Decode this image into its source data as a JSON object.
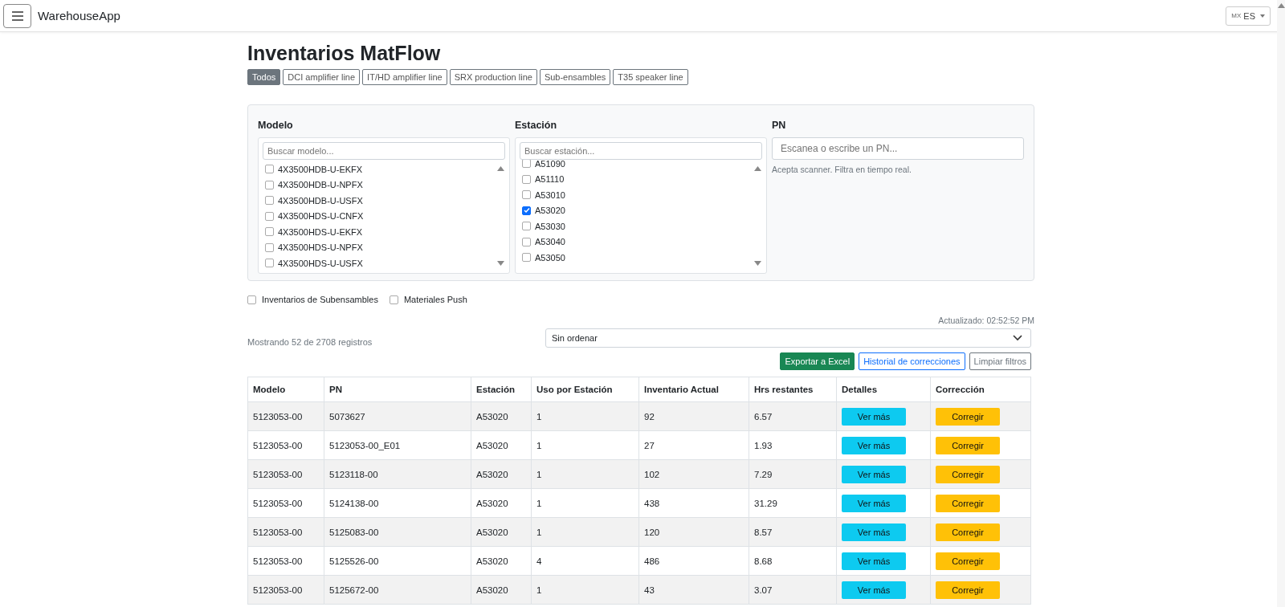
{
  "navbar": {
    "brand": "WarehouseApp",
    "language": {
      "flag": "MX",
      "label": "ES"
    }
  },
  "title": "Inventarios MatFlow",
  "line_tabs": [
    {
      "label": "Todos",
      "selected": true
    },
    {
      "label": "DCI amplifier line",
      "selected": false
    },
    {
      "label": "IT/HD amplifier line",
      "selected": false
    },
    {
      "label": "SRX production line",
      "selected": false
    },
    {
      "label": "Sub-ensambles",
      "selected": false
    },
    {
      "label": "T35 speaker line",
      "selected": false
    }
  ],
  "filters": {
    "modelo": {
      "label": "Modelo",
      "placeholder": "Buscar modelo...",
      "items": [
        {
          "label": "4X3500HDB-U-EKFX",
          "checked": false
        },
        {
          "label": "4X3500HDB-U-NPFX",
          "checked": false
        },
        {
          "label": "4X3500HDB-U-USFX",
          "checked": false
        },
        {
          "label": "4X3500HDS-U-CNFX",
          "checked": false
        },
        {
          "label": "4X3500HDS-U-EKFX",
          "checked": false
        },
        {
          "label": "4X3500HDS-U-NPFX",
          "checked": false
        },
        {
          "label": "4X3500HDS-U-USFX",
          "checked": false
        }
      ]
    },
    "estacion": {
      "label": "Estación",
      "placeholder": "Buscar estación...",
      "items": [
        {
          "label": "A51090",
          "checked": false
        },
        {
          "label": "A51110",
          "checked": false
        },
        {
          "label": "A53010",
          "checked": false
        },
        {
          "label": "A53020",
          "checked": true
        },
        {
          "label": "A53030",
          "checked": false
        },
        {
          "label": "A53040",
          "checked": false
        },
        {
          "label": "A53050",
          "checked": false
        }
      ]
    },
    "pn": {
      "label": "PN",
      "placeholder": "Escanea o escribe un PN...",
      "hint": "Acepta scanner. Filtra en tiempo real."
    }
  },
  "options": [
    {
      "label": "Inventarios de Subensambles",
      "checked": false
    },
    {
      "label": "Materiales Push",
      "checked": false
    }
  ],
  "updated": "Actualizado: 02:52:52 PM",
  "count": "Mostrando 52 de 2708 registros",
  "sort": {
    "value": "Sin ordenar"
  },
  "actions": [
    {
      "label": "Exportar a Excel",
      "kind": "success"
    },
    {
      "label": "Historial de correcciones",
      "kind": "outline-primary"
    },
    {
      "label": "Limpiar filtros",
      "kind": "outline-secondary"
    }
  ],
  "table": {
    "columns": [
      "Modelo",
      "PN",
      "Estación",
      "Uso por Estación",
      "Inventario Actual",
      "Hrs restantes",
      "Detalles",
      "Corrección"
    ],
    "rows": [
      {
        "cells": [
          "5123053-00",
          "5073627",
          "A53020",
          "1",
          "92",
          "6.57"
        ],
        "details": "Ver más",
        "fix": "Corregir"
      },
      {
        "cells": [
          "5123053-00",
          "5123053-00_E01",
          "A53020",
          "1",
          "27",
          "1.93"
        ],
        "details": "Ver más",
        "fix": "Corregir"
      },
      {
        "cells": [
          "5123053-00",
          "5123118-00",
          "A53020",
          "1",
          "102",
          "7.29"
        ],
        "details": "Ver más",
        "fix": "Corregir"
      },
      {
        "cells": [
          "5123053-00",
          "5124138-00",
          "A53020",
          "1",
          "438",
          "31.29"
        ],
        "details": "Ver más",
        "fix": "Corregir"
      },
      {
        "cells": [
          "5123053-00",
          "5125083-00",
          "A53020",
          "1",
          "120",
          "8.57"
        ],
        "details": "Ver más",
        "fix": "Corregir"
      },
      {
        "cells": [
          "5123053-00",
          "5125526-00",
          "A53020",
          "4",
          "486",
          "8.68"
        ],
        "details": "Ver más",
        "fix": "Corregir"
      },
      {
        "cells": [
          "5123053-00",
          "5125672-00",
          "A53020",
          "1",
          "43",
          "3.07"
        ],
        "details": "Ver más",
        "fix": "Corregir"
      }
    ]
  }
}
